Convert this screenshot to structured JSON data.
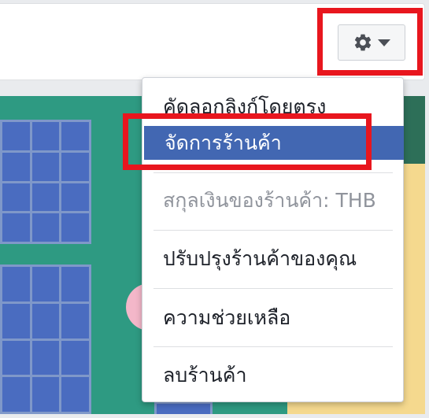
{
  "header": {
    "settings_button": {
      "gear_icon": "gear-icon",
      "caret_icon": "caret-down-icon"
    }
  },
  "menu": {
    "items": [
      {
        "label": "คัดลอกลิงก์โดยตรง",
        "state": "normal"
      },
      {
        "label": "จัดการร้านค้า",
        "state": "highlighted"
      },
      {
        "label": "สกุลเงินของร้านค้า: THB",
        "state": "disabled"
      },
      {
        "label": "ปรับปรุงร้านค้าของคุณ",
        "state": "normal"
      },
      {
        "label": "ความช่วยเหลือ",
        "state": "normal"
      },
      {
        "label": "ลบร้านค้า",
        "state": "normal"
      }
    ]
  },
  "colors": {
    "highlight": "#4267b2",
    "annotation": "#e8161e",
    "cover_green": "#2e9a82",
    "window_blue": "#3b5fb0"
  }
}
